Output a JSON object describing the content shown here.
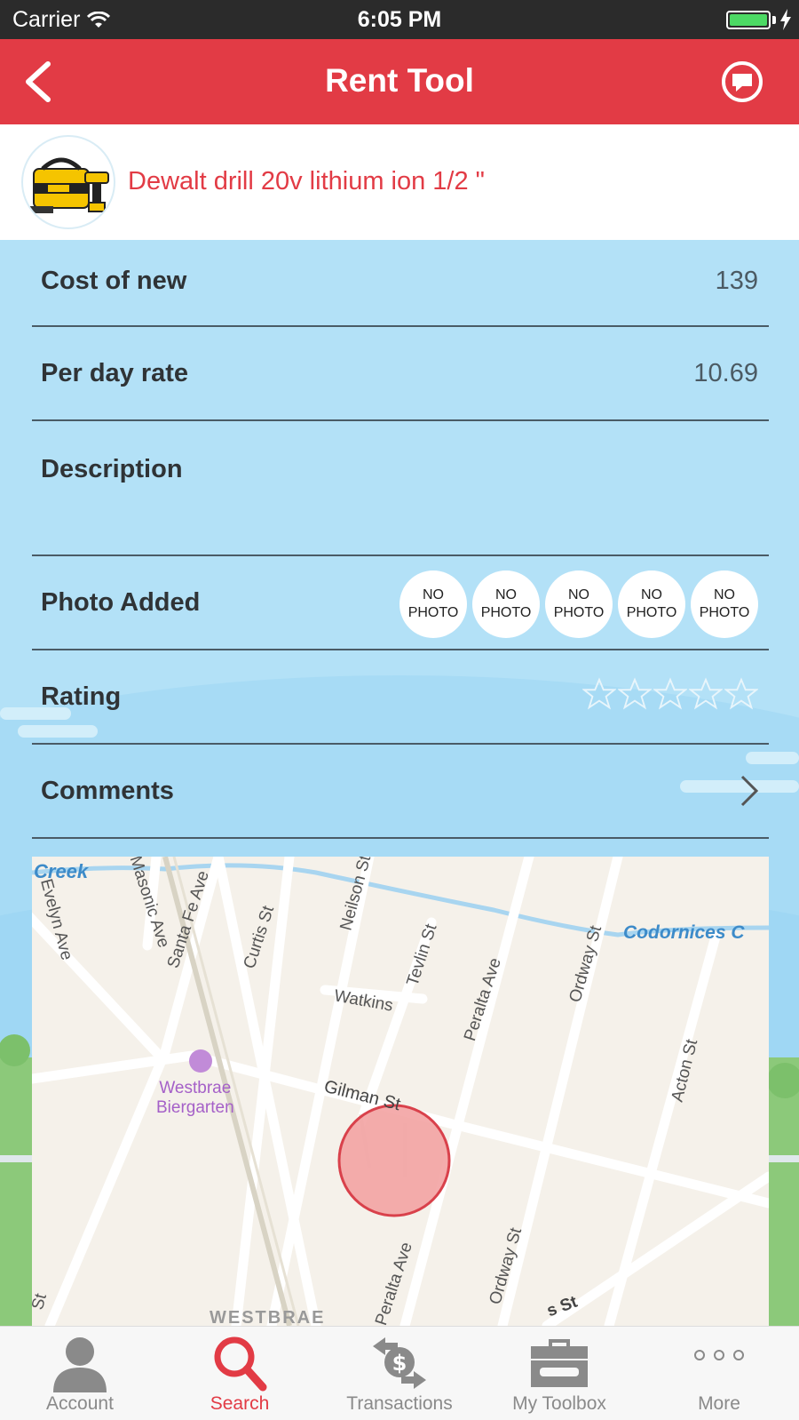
{
  "status_bar": {
    "carrier": "Carrier",
    "time": "6:05 PM"
  },
  "nav": {
    "title": "Rent Tool",
    "back_icon": "chevron-left-icon",
    "chat_icon": "chat-bubble-icon"
  },
  "tool": {
    "name": "Dewalt drill 20v lithium ion 1/2 \""
  },
  "details": {
    "cost_label": "Cost of new",
    "cost_value": "139",
    "rate_label": "Per day rate",
    "rate_value": "10.69",
    "description_label": "Description",
    "description_value": "",
    "photos_label": "Photo Added",
    "photos": [
      {
        "line1": "NO",
        "line2": "PHOTO"
      },
      {
        "line1": "NO",
        "line2": "PHOTO"
      },
      {
        "line1": "NO",
        "line2": "PHOTO"
      },
      {
        "line1": "NO",
        "line2": "PHOTO"
      },
      {
        "line1": "NO",
        "line2": "PHOTO"
      }
    ],
    "rating_label": "Rating",
    "rating_value": 0,
    "rating_max": 5,
    "comments_label": "Comments"
  },
  "map": {
    "water_labels": {
      "creek": "Creek",
      "codornices": "Codornices C"
    },
    "streets": {
      "masonic": "Masonic Ave",
      "santa_fe": "Santa Fe Ave",
      "curtis": "Curtis St",
      "neilson": "Neilson St",
      "tevlin": "Tevlin St",
      "watkins": "Watkins",
      "peralta": "Peralta Ave",
      "ordway": "Ordway St",
      "acton": "Acton St",
      "gilman": "Gilman St",
      "evelyn": "Evelyn Ave",
      "ordway_lower": "Ordway St",
      "peralta_lower": "Peralta Ave",
      "corner_st": "St",
      "bottom_st": "s St"
    },
    "poi": {
      "line1": "Westbrae",
      "line2": "Biergarten"
    },
    "neighborhood": "WESTBRAE"
  },
  "tabs": [
    {
      "label": "Account",
      "icon": "person-icon",
      "active": false
    },
    {
      "label": "Search",
      "icon": "search-icon",
      "active": true
    },
    {
      "label": "Transactions",
      "icon": "dollar-exchange-icon",
      "active": false
    },
    {
      "label": "My Toolbox",
      "icon": "toolbox-icon",
      "active": false
    },
    {
      "label": "More",
      "icon": "more-dots-icon",
      "active": false
    }
  ],
  "colors": {
    "accent": "#e23b45",
    "sky": "#b3e1f7",
    "divider": "#4a5b66"
  }
}
